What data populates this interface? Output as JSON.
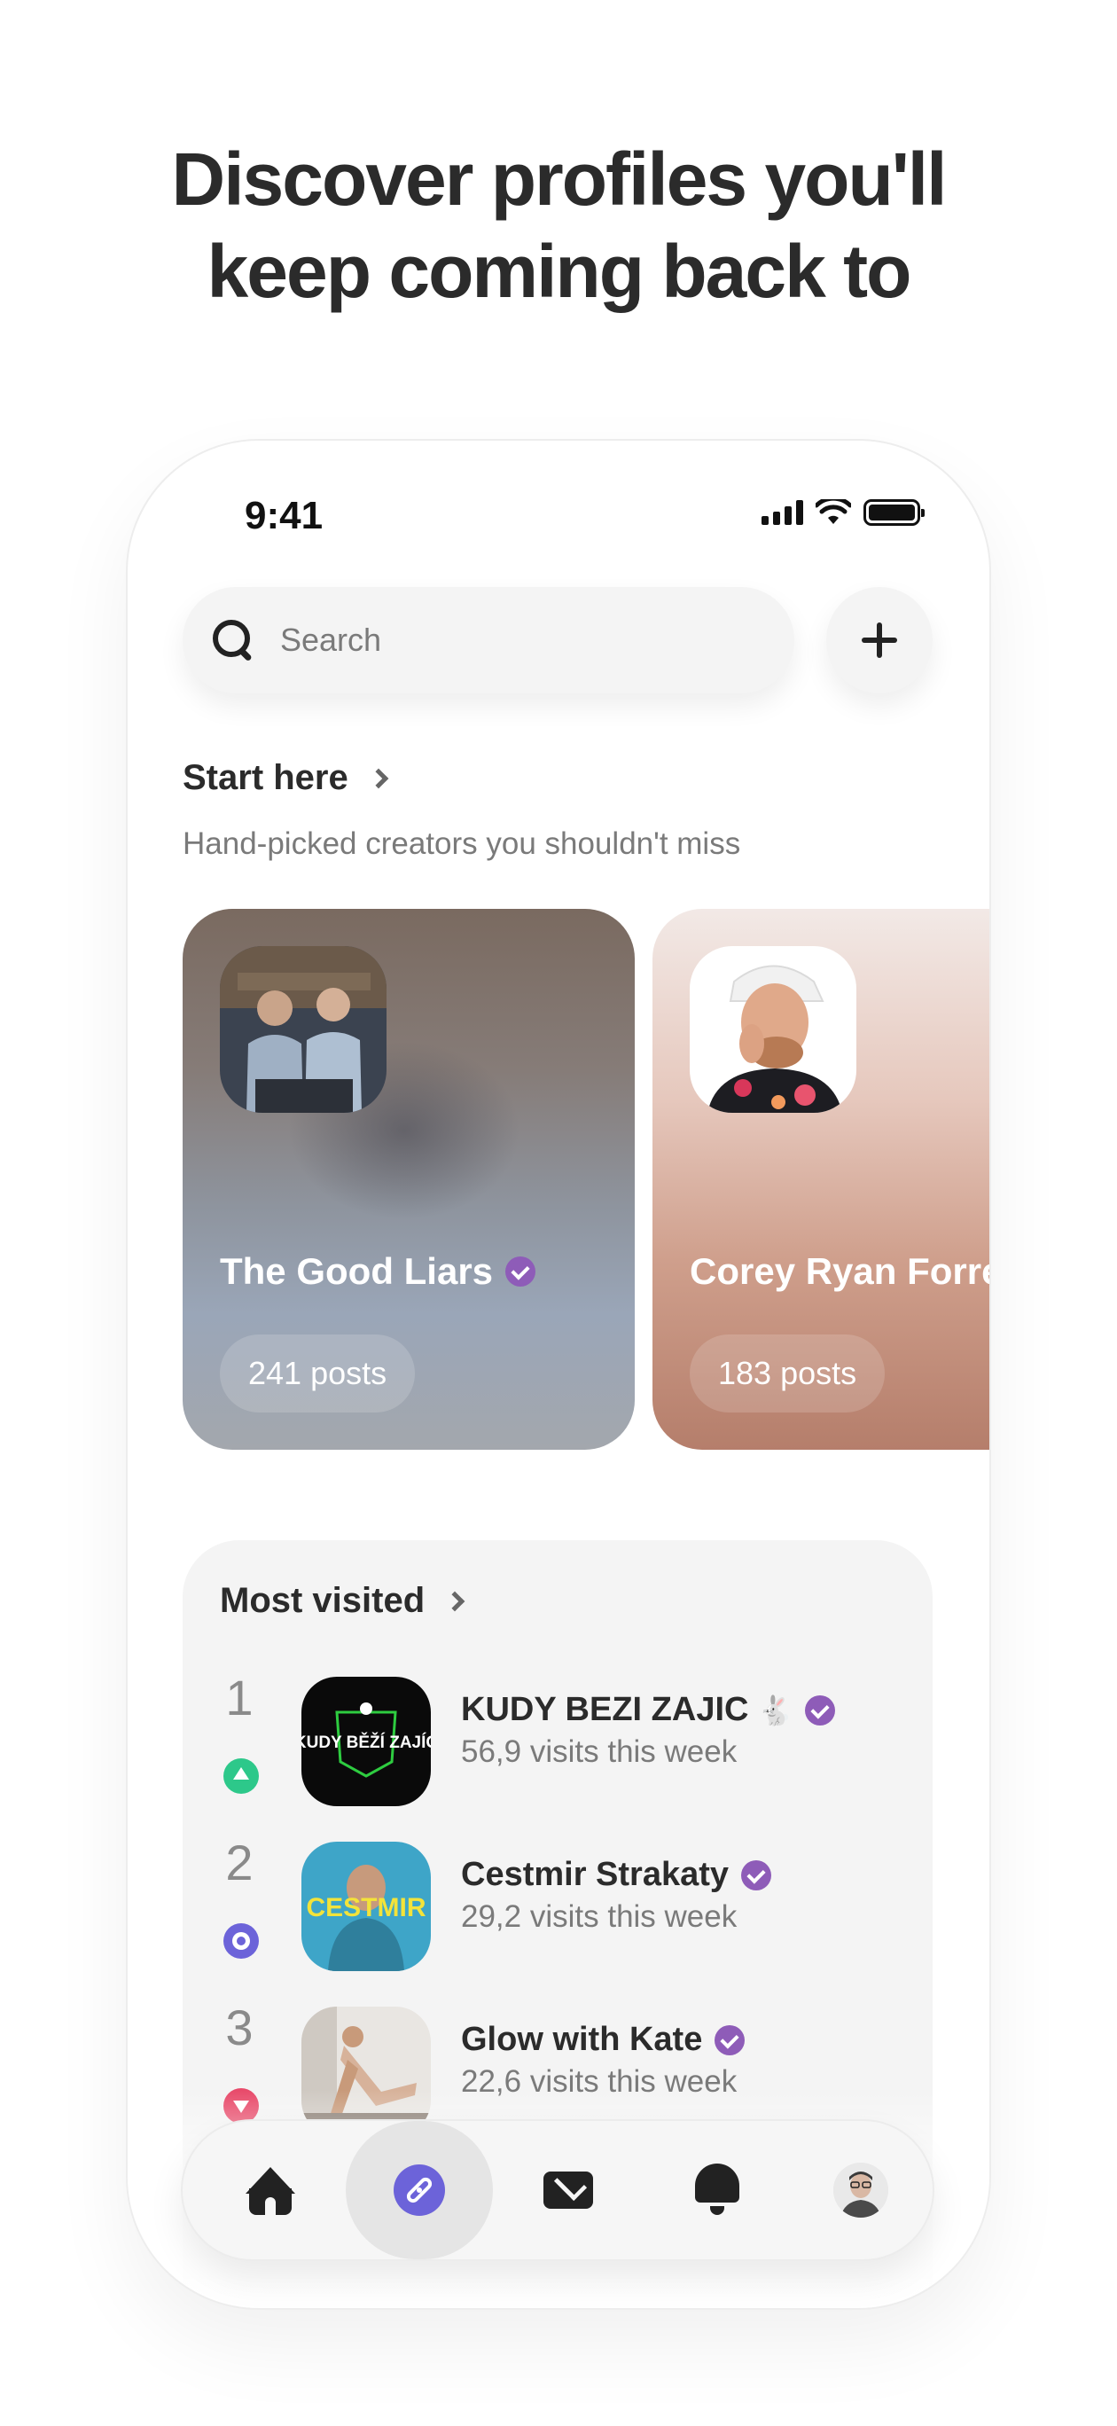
{
  "headline": {
    "line1": "Discover profiles you'll",
    "line2": "keep coming back to"
  },
  "status_bar": {
    "time": "9:41"
  },
  "search": {
    "placeholder": "Search"
  },
  "start_here": {
    "title": "Start here",
    "subtitle": "Hand-picked creators you shouldn't miss",
    "cards": [
      {
        "name": "The Good Liars",
        "posts": "241 posts",
        "verified": true
      },
      {
        "name": "Corey Ryan Forrester",
        "posts": "183 posts",
        "verified": false
      }
    ]
  },
  "most_visited": {
    "title": "Most visited",
    "items": [
      {
        "rank": "1",
        "name": "KUDY BEZI ZAJIC",
        "emoji": "🐇",
        "visits": "56,9 visits this week",
        "trend": "up",
        "thumb_text": "KUDY BĚŽÍ ZAJÍC"
      },
      {
        "rank": "2",
        "name": "Cestmir Strakaty",
        "emoji": "",
        "visits": "29,2 visits this week",
        "trend": "same",
        "thumb_text": "CESTMIR"
      },
      {
        "rank": "3",
        "name": "Glow with Kate",
        "emoji": "",
        "visits": "22,6 visits this week",
        "trend": "down",
        "thumb_text": ""
      }
    ]
  },
  "tab_bar": {
    "items": [
      "home-icon",
      "compass-icon",
      "mail-icon",
      "bell-icon",
      "profile-avatar"
    ],
    "active": "compass-icon"
  },
  "colors": {
    "accent": "#6c63d9",
    "verified": "#8e5cb8",
    "trend_up": "#2dc88a",
    "trend_down": "#e84a6a"
  }
}
